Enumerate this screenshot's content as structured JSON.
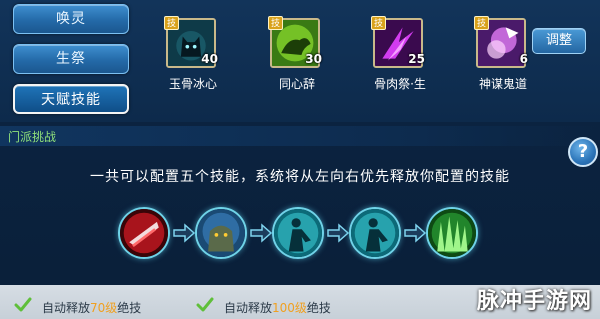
{
  "nav": {
    "items": [
      {
        "label": "唤灵",
        "active": false
      },
      {
        "label": "生祭",
        "active": false
      },
      {
        "label": "天赋技能",
        "active": true
      }
    ]
  },
  "skills": [
    {
      "badge": "技",
      "level": "40",
      "name": "玉骨冰心",
      "icon": "black-cat-icon",
      "color": "#1e5a6a"
    },
    {
      "badge": "技",
      "level": "30",
      "name": "同心辞",
      "icon": "green-beast-icon",
      "color": "#6fbf2a"
    },
    {
      "badge": "技",
      "level": "25",
      "name": "骨肉祭·生",
      "icon": "purple-claw-icon",
      "color": "#b02ad0"
    },
    {
      "badge": "技",
      "level": "6",
      "name": "神谋鬼道",
      "icon": "pink-spirit-icon",
      "color": "#c46ae0"
    }
  ],
  "adjust_button": "调整",
  "section": {
    "title": "门派挑战"
  },
  "help_label": "?",
  "hint": "一共可以配置五个技能，系统将从左向右优先释放你配置的技能",
  "chain": [
    {
      "icon": "red-slash-icon"
    },
    {
      "icon": "stone-golem-icon"
    },
    {
      "icon": "shadow-figure-icon"
    },
    {
      "icon": "shadow-figure-icon"
    },
    {
      "icon": "green-spikes-icon"
    }
  ],
  "auto_options": [
    {
      "prefix": "自动释放",
      "level": "70级",
      "suffix": "绝技"
    },
    {
      "prefix": "自动释放",
      "level": "100级",
      "suffix": "绝技"
    }
  ],
  "watermark": "脉冲手游网",
  "colors": {
    "accent": "#2466a2",
    "section_title": "#8fe07a",
    "level_highlight": "#f0a020"
  }
}
